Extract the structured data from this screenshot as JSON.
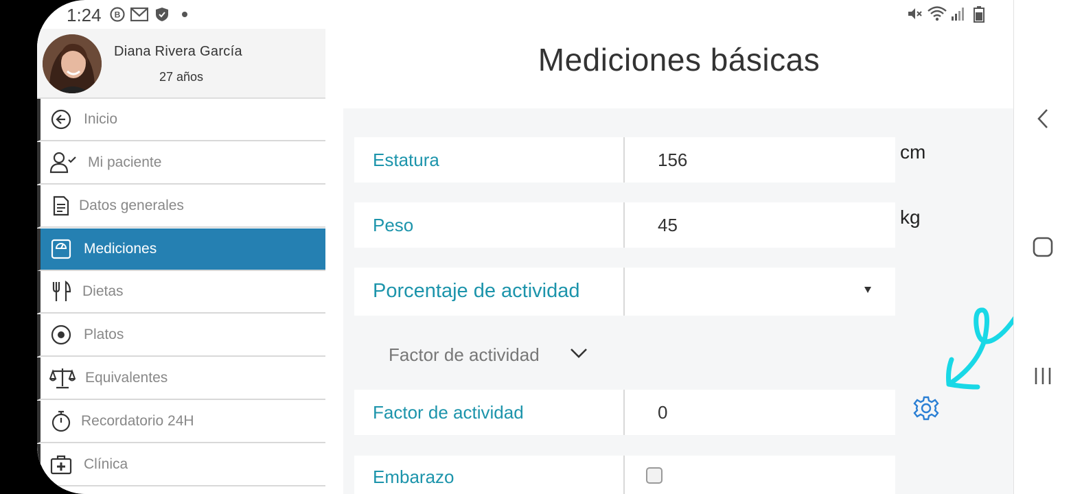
{
  "status_bar": {
    "time": "1:24"
  },
  "profile": {
    "name": "Diana Rivera García",
    "age": "27 años"
  },
  "menu": [
    {
      "label": "Inicio",
      "icon": "arrow-circle-left-icon",
      "active": false
    },
    {
      "label": "Mi paciente",
      "icon": "user-check-icon",
      "active": false
    },
    {
      "label": "Datos generales",
      "icon": "document-icon",
      "active": false
    },
    {
      "label": "Mediciones",
      "icon": "scale-icon",
      "active": true
    },
    {
      "label": "Dietas",
      "icon": "utensils-icon",
      "active": false
    },
    {
      "label": "Platos",
      "icon": "plate-icon",
      "active": false
    },
    {
      "label": "Equivalentes",
      "icon": "balance-icon",
      "active": false
    },
    {
      "label": "Recordatorio 24H",
      "icon": "stopwatch-icon",
      "active": false
    },
    {
      "label": "Clínica",
      "icon": "medical-kit-icon",
      "active": false
    }
  ],
  "main": {
    "title": "Mediciones básicas",
    "fields": {
      "estatura": {
        "label": "Estatura",
        "value": "156",
        "unit": "cm"
      },
      "peso": {
        "label": "Peso",
        "value": "45",
        "unit": "kg"
      },
      "porcentaje": {
        "label": "Porcentaje de actividad",
        "value": ""
      },
      "factor_toggle": "Factor de actividad",
      "factor": {
        "label": "Factor de actividad",
        "value": "0"
      },
      "embarazo": {
        "label": "Embarazo",
        "checked": false
      }
    }
  },
  "colors": {
    "accent": "#2580b2",
    "label": "#1c94ab",
    "annotation": "#19d8e6"
  }
}
